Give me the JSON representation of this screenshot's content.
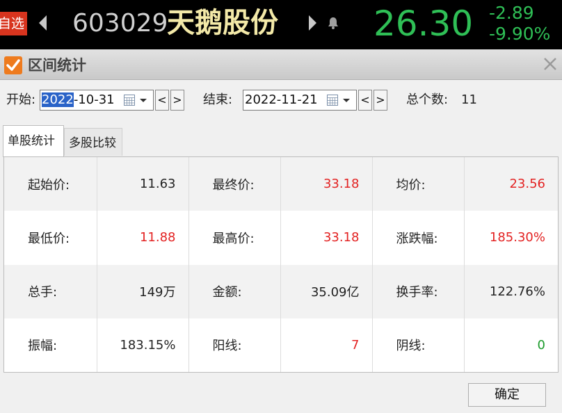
{
  "quote": {
    "favorite_label": "自选",
    "code": "603029",
    "name": "天鹅股份",
    "price": "26.30",
    "change": "-2.89",
    "change_pct": "-9.90%",
    "up_color": "#e32222",
    "down_color": "#2fbf56"
  },
  "dialog": {
    "title": "区间统计",
    "start_label": "开始:",
    "start_date_selected": "2022",
    "start_date_rest": "-10-31",
    "end_label": "结束:",
    "end_date": "2022-11-21",
    "prev_label": "<",
    "next_label": ">",
    "total_label": "总个数:",
    "total_value": "11",
    "tabs": [
      "单股统计",
      "多股比较"
    ],
    "ok_label": "确定"
  },
  "stats": [
    [
      {
        "label": "起始价:",
        "value": "11.63",
        "color": "default"
      },
      {
        "label": "最终价:",
        "value": "33.18",
        "color": "red"
      },
      {
        "label": "均价:",
        "value": "23.56",
        "color": "red"
      }
    ],
    [
      {
        "label": "最低价:",
        "value": "11.88",
        "color": "red"
      },
      {
        "label": "最高价:",
        "value": "33.18",
        "color": "red"
      },
      {
        "label": "涨跌幅:",
        "value": "185.30%",
        "color": "red"
      }
    ],
    [
      {
        "label": "总手:",
        "value": "149万",
        "color": "default"
      },
      {
        "label": "金额:",
        "value": "35.09亿",
        "color": "default"
      },
      {
        "label": "换手率:",
        "value": "122.76%",
        "color": "default"
      }
    ],
    [
      {
        "label": "振幅:",
        "value": "183.15%",
        "color": "default"
      },
      {
        "label": "阳线:",
        "value": "7",
        "color": "red"
      },
      {
        "label": "阴线:",
        "value": "0",
        "color": "green"
      }
    ]
  ]
}
